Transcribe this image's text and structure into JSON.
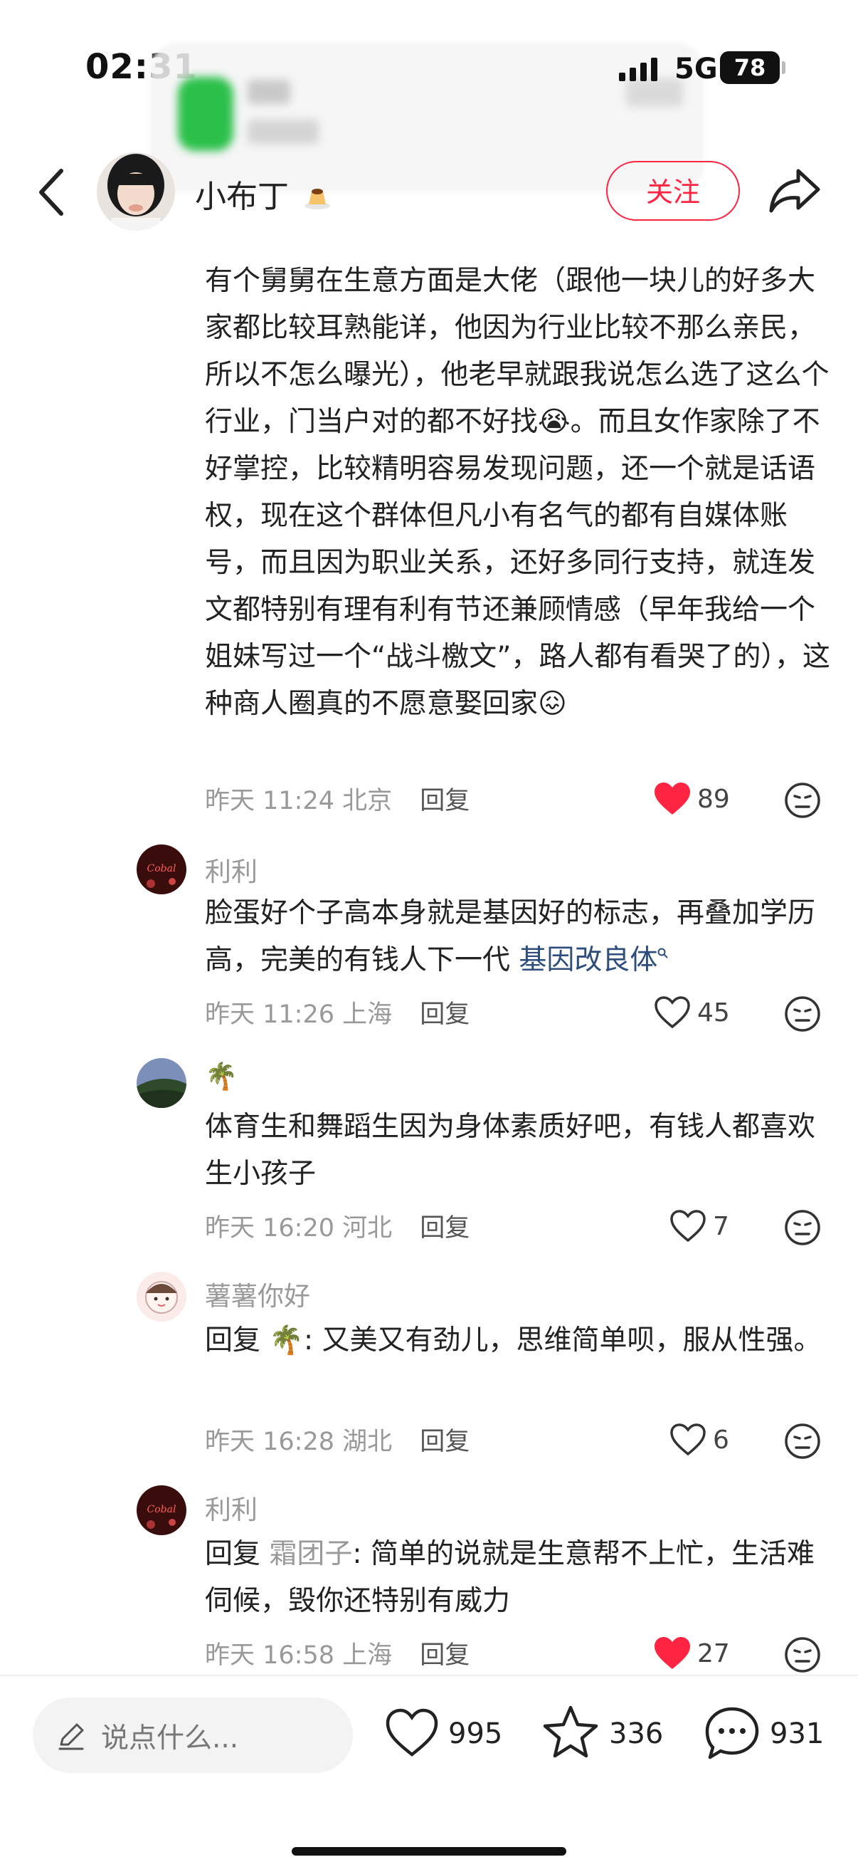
{
  "status_bar": {
    "time": "02:31",
    "network": "5G",
    "battery": "78"
  },
  "header": {
    "author": "小布丁",
    "follow_label": "关注"
  },
  "comments": [
    {
      "text": "有个舅舅在生意方面是大佬（跟他一块儿的好多大家都比较耳熟能详，他因为行业比较不那么亲民，所以不怎么曝光），他老早就跟我说怎么选了这么个行业，门当户对的都不好找😭。而且女作家除了不好掌控，比较精明容易发现问题，还一个就是话语权，现在这个群体但凡小有名气的都有自媒体账号，而且因为职业关系，还好多同行支持，就连发文都特别有理有利有节还兼顾情感（早年我给一个姐妹写过一个“战斗檄文”，路人都有看哭了的），这种商人圈真的不愿意娶回家😖",
      "time": "昨天 11:24 北京",
      "reply": "回复",
      "likes": "89"
    },
    {
      "user": "利利",
      "text_before": "脸蛋好个子高本身就是基因好的标志，再叠加学历高，完美的有钱人下一代 ",
      "tag": "基因改良体",
      "time": "昨天 11:26 上海",
      "reply": "回复",
      "likes": "45"
    },
    {
      "user": "🌴",
      "text": "体育生和舞蹈生因为身体素质好吧，有钱人都喜欢生小孩子",
      "time": "昨天 16:20 河北",
      "reply": "回复",
      "likes": "7"
    },
    {
      "user": "薯薯你好",
      "reply_prefix": "回复 ",
      "reply_to": "🌴",
      "text": ": 又美又有劲儿，思维简单呗，服从性强。",
      "time": "昨天 16:28 湖北",
      "reply": "回复",
      "likes": "6"
    },
    {
      "user": "利利",
      "reply_prefix": "回复 ",
      "reply_to": "霜团子",
      "text": ": 简单的说就是生意帮不上忙，生活难伺候，毁你还特别有威力",
      "time": "昨天 16:58 上海",
      "reply": "回复",
      "likes": "27"
    }
  ],
  "bottom_bar": {
    "placeholder": "说点什么...",
    "likes": "995",
    "stars": "336",
    "comments": "931"
  },
  "colors": {
    "accent": "#ff2442",
    "like_active": "#ff2442",
    "tag_link": "#2d4e7c"
  }
}
